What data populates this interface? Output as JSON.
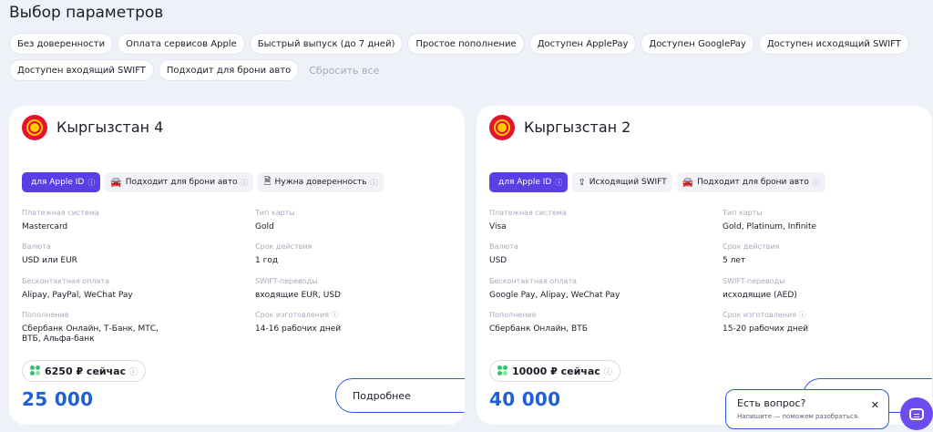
{
  "page_title": "Выбор параметров",
  "filters": [
    "Без доверенности",
    "Оплата сервисов Apple",
    "Быстрый выпуск (до 7 дней)",
    "Простое пополнение",
    "Доступен ApplePay",
    "Доступен GooglePay",
    "Доступен исходящий SWIFT",
    "Доступен входящий SWIFT",
    "Подходит для брони авто"
  ],
  "reset_label": "Сбросить все",
  "cards": [
    {
      "title": "Кыргызстан 4",
      "tags": [
        "для Apple ID",
        "Подходит для брони авто",
        "Нужна доверенность"
      ],
      "specs": {
        "payment_system_label": "Платежная система",
        "payment_system": "Mastercard",
        "card_type_label": "Тип карты",
        "card_type": "Gold",
        "currency_label": "Валюта",
        "currency": "USD или EUR",
        "validity_label": "Срок действия",
        "validity": "1 год",
        "contactless_label": "Бесконтактная оплата",
        "contactless": "Alipay, PayPal, WeChat Pay",
        "swift_label": "SWIFT-переводы",
        "swift": "входящие EUR, USD",
        "topup_label": "Пополнение",
        "topup": "Сбербанк Онлайн, Т-Банк, МТС, ВТБ, Альфа-банк",
        "production_label": "Срок изготовления",
        "production": "14-16 рабочих дней"
      },
      "badge": "6250 ₽ сейчас",
      "price": "25 000",
      "button": "Подробнее"
    },
    {
      "title": "Кыргызстан 2",
      "tags": [
        "для Apple ID",
        "Исходящий SWIFT",
        "Подходит для брони авто"
      ],
      "specs": {
        "payment_system_label": "Платежная система",
        "payment_system": "Visa",
        "card_type_label": "Тип карты",
        "card_type": "Gold, Platinum, Infinite",
        "currency_label": "Валюта",
        "currency": "USD",
        "validity_label": "Срок действия",
        "validity": "5 лет",
        "contactless_label": "Бесконтактная оплата",
        "contactless": "Google Pay, Alipay, WeChat Pay",
        "swift_label": "SWIFT-переводы",
        "swift": "исходящие (AED)",
        "topup_label": "Пополнение",
        "topup": "Сбербанк Онлайн, ВТБ",
        "production_label": "Срок изготовления",
        "production": "15-20 рабочих дней"
      },
      "badge": "10000 ₽ сейчас",
      "price": "40 000"
    }
  ],
  "chat": {
    "title": "Есть вопрос?",
    "subtitle": "Напишите — поможем разобраться.",
    "close": "✕"
  },
  "colors": {
    "accent": "#5a3ee6",
    "price": "#1f5fd6",
    "flag_red": "#e8112d",
    "flag_sun": "#ffcc00"
  },
  "icons": [
    "apple-icon",
    "car-icon",
    "document-icon",
    "swift-icon",
    "info-icon",
    "chat-icon",
    "close-icon"
  ]
}
